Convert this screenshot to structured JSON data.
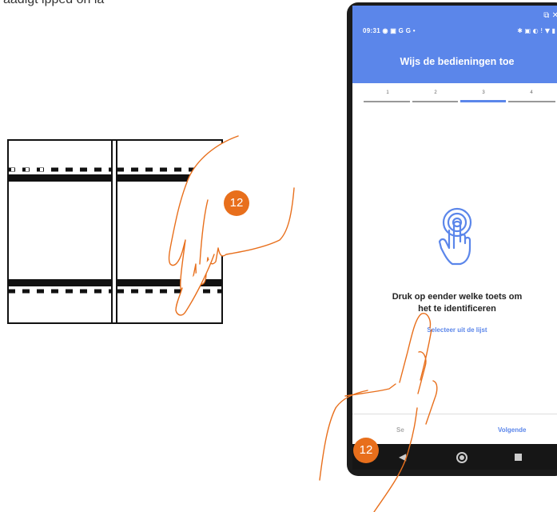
{
  "caption": {
    "top_text": "aadigt ipped on ia"
  },
  "phone": {
    "status": {
      "time": "09:31",
      "left_icons": "◉ ▣ G G •",
      "right_icons": "✱ ▣ ◐ ! ▼ ▮"
    },
    "corner_icons": "⧉ ✕",
    "title": "Wijs de bedieningen toe",
    "steps": [
      "1",
      "2",
      "3",
      "4"
    ],
    "active_step": 3,
    "instruction_line1": "Druk op eender welke toets om",
    "instruction_line2": "het te identificeren",
    "select_link": "Selecteer uit de lijst",
    "back_label": "Se",
    "next_label": "Volgende",
    "nav_back_icon": "◀"
  },
  "callouts": {
    "left_number": "12",
    "right_number": "12"
  },
  "colors": {
    "accent": "#5b86ea",
    "badge": "#e86f1c",
    "hand_stroke": "#e86f1c"
  }
}
